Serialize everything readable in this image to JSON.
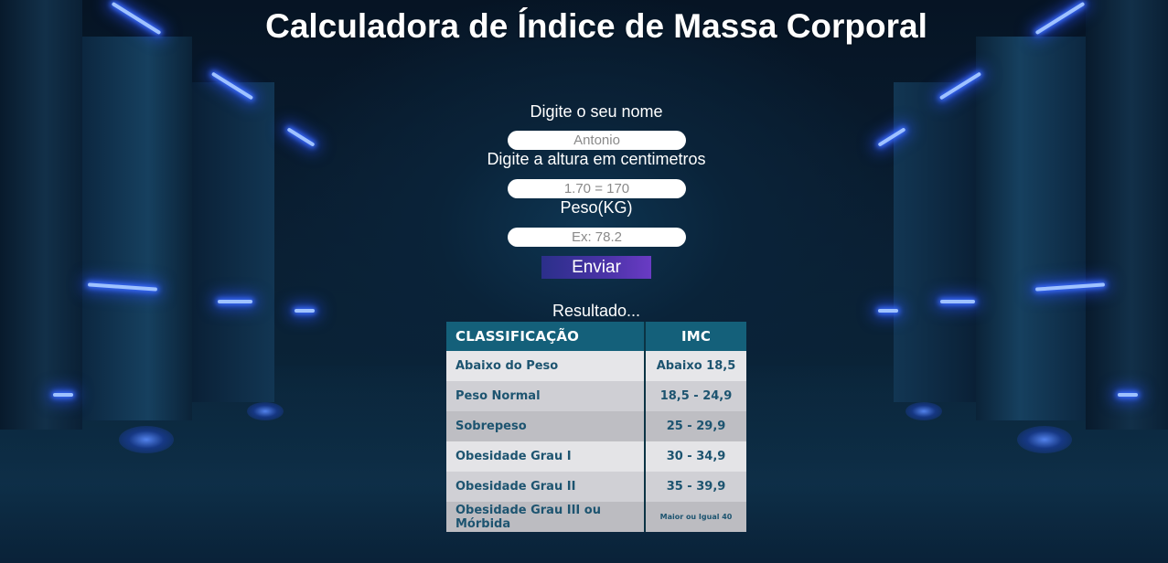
{
  "page": {
    "title": "Calculadora de Índice de Massa Corporal"
  },
  "form": {
    "name_label": "Digite o seu nome",
    "name_placeholder": "Antonio",
    "height_label": "Digite a altura em centimetros",
    "height_placeholder": "1.70 = 170",
    "weight_label": "Peso(KG)",
    "weight_placeholder": "Ex: 78.2",
    "submit_label": "Enviar"
  },
  "result": {
    "label": "Resultado..."
  },
  "table": {
    "headers": [
      "CLASSIFICAÇÃO",
      "IMC"
    ],
    "rows": [
      {
        "classification": "Abaixo do Peso",
        "imc": "Abaixo 18,5"
      },
      {
        "classification": "Peso Normal",
        "imc": "18,5 - 24,9"
      },
      {
        "classification": "Sobrepeso",
        "imc": "25 - 29,9"
      },
      {
        "classification": "Obesidade Grau I",
        "imc": "30 - 34,9"
      },
      {
        "classification": "Obesidade Grau II",
        "imc": "35 - 39,9"
      },
      {
        "classification": "Obesidade Grau III ou Mórbida",
        "imc": "Maior ou Igual 40"
      }
    ]
  },
  "colors": {
    "table_header": "#14607a",
    "table_text": "#1d5470",
    "button_gradient_start": "#2b2f8a",
    "button_gradient_end": "#6a3bc4",
    "neon": "#3a6bff"
  }
}
